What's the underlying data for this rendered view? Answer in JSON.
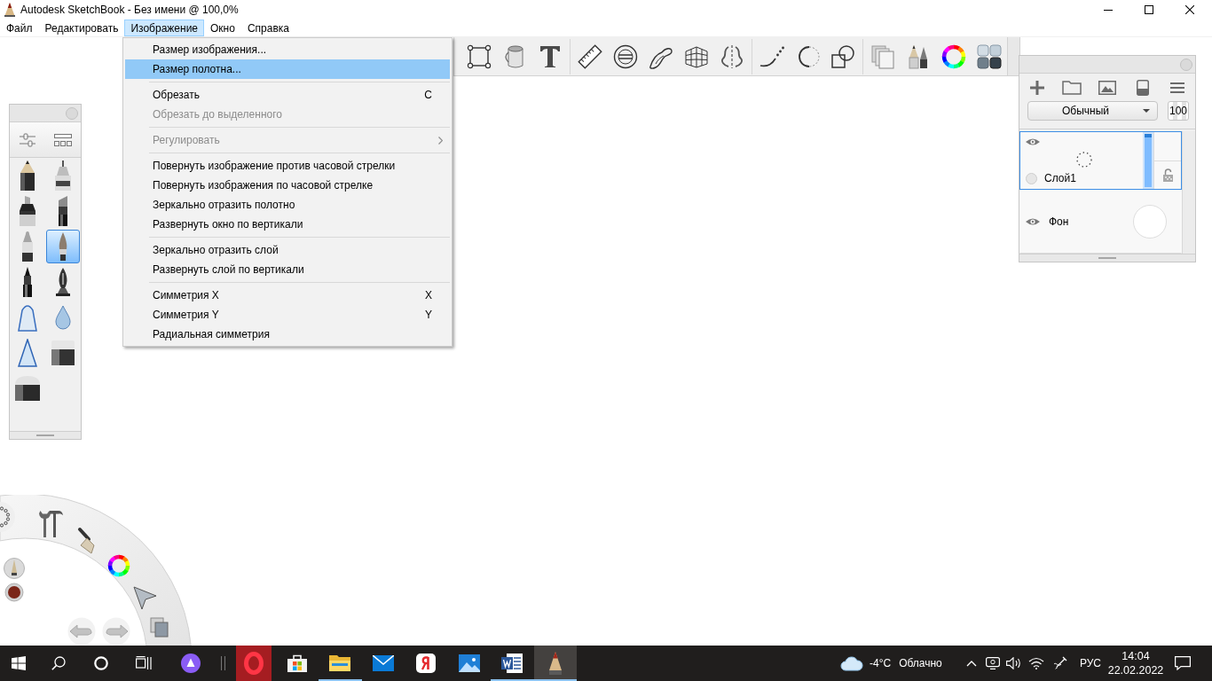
{
  "window": {
    "title": "Autodesk SketchBook - Без имени @ 100,0%"
  },
  "menu_bar": [
    {
      "label": "Файл",
      "selected": false
    },
    {
      "label": "Редактировать",
      "selected": false
    },
    {
      "label": "Изображение",
      "selected": true
    },
    {
      "label": "Окно",
      "selected": false
    },
    {
      "label": "Справка",
      "selected": false
    }
  ],
  "dropdown": {
    "groups": [
      [
        {
          "label": "Размер изображения...",
          "selected": false,
          "disabled": false,
          "submenu": false
        },
        {
          "label": "Размер полотна...",
          "selected": true,
          "disabled": false,
          "submenu": false
        }
      ],
      [
        {
          "label": "Обрезать",
          "shortcut": "C",
          "selected": false,
          "disabled": false,
          "submenu": false
        },
        {
          "label": "Обрезать до выделенного",
          "selected": false,
          "disabled": true,
          "submenu": false
        }
      ],
      [
        {
          "label": "Регулировать",
          "selected": false,
          "disabled": true,
          "submenu": true
        }
      ],
      [
        {
          "label": "Повернуть изображение против часовой стрелки",
          "selected": false,
          "disabled": false,
          "submenu": false
        },
        {
          "label": "Повернуть изображения по часовой стрелке",
          "selected": false,
          "disabled": false,
          "submenu": false
        },
        {
          "label": "Зеркально отразить полотно",
          "selected": false,
          "disabled": false,
          "submenu": false
        },
        {
          "label": "Развернуть окно по вертикали",
          "selected": false,
          "disabled": false,
          "submenu": false
        }
      ],
      [
        {
          "label": "Зеркально отразить слой",
          "selected": false,
          "disabled": false,
          "submenu": false
        },
        {
          "label": "Развернуть слой по вертикали",
          "selected": false,
          "disabled": false,
          "submenu": false
        }
      ],
      [
        {
          "label": "Симметрия X",
          "shortcut": "X",
          "selected": false,
          "disabled": false,
          "submenu": false
        },
        {
          "label": "Симметрия Y",
          "shortcut": "Y",
          "selected": false,
          "disabled": false,
          "submenu": false
        },
        {
          "label": "Радиальная симметрия",
          "selected": false,
          "disabled": false,
          "submenu": false
        }
      ]
    ]
  },
  "brush_palette": {
    "brushes": [
      {
        "selected": false
      },
      {
        "selected": false
      },
      {
        "selected": false
      },
      {
        "selected": false
      },
      {
        "selected": false
      },
      {
        "selected": true
      },
      {
        "selected": false
      },
      {
        "selected": false
      },
      {
        "selected": false
      },
      {
        "selected": false
      },
      {
        "selected": false
      },
      {
        "selected": false
      },
      {
        "selected": false
      }
    ]
  },
  "layers_panel": {
    "blend_mode": "Обычный",
    "opacity": "100",
    "layers": [
      {
        "name": "Слой1",
        "selected": true,
        "visible": true,
        "level": 1
      },
      {
        "name": "Фон",
        "selected": false,
        "visible": true
      }
    ]
  },
  "lagoon": {
    "color": "#7a2518"
  },
  "taskbar": {
    "apps": [
      {
        "running": false,
        "active": false
      },
      {
        "running": false,
        "active": false
      },
      {
        "running": true,
        "active": false
      },
      {
        "running": false,
        "active": false
      },
      {
        "running": false,
        "active": false
      },
      {
        "running": false,
        "active": false
      },
      {
        "running": true,
        "active": false
      },
      {
        "running": true,
        "active": true
      }
    ],
    "weather": {
      "temperature": "-4°C",
      "condition": "Облачно"
    },
    "language": "РУС",
    "time": "14:04",
    "date": "22.02.2022"
  }
}
